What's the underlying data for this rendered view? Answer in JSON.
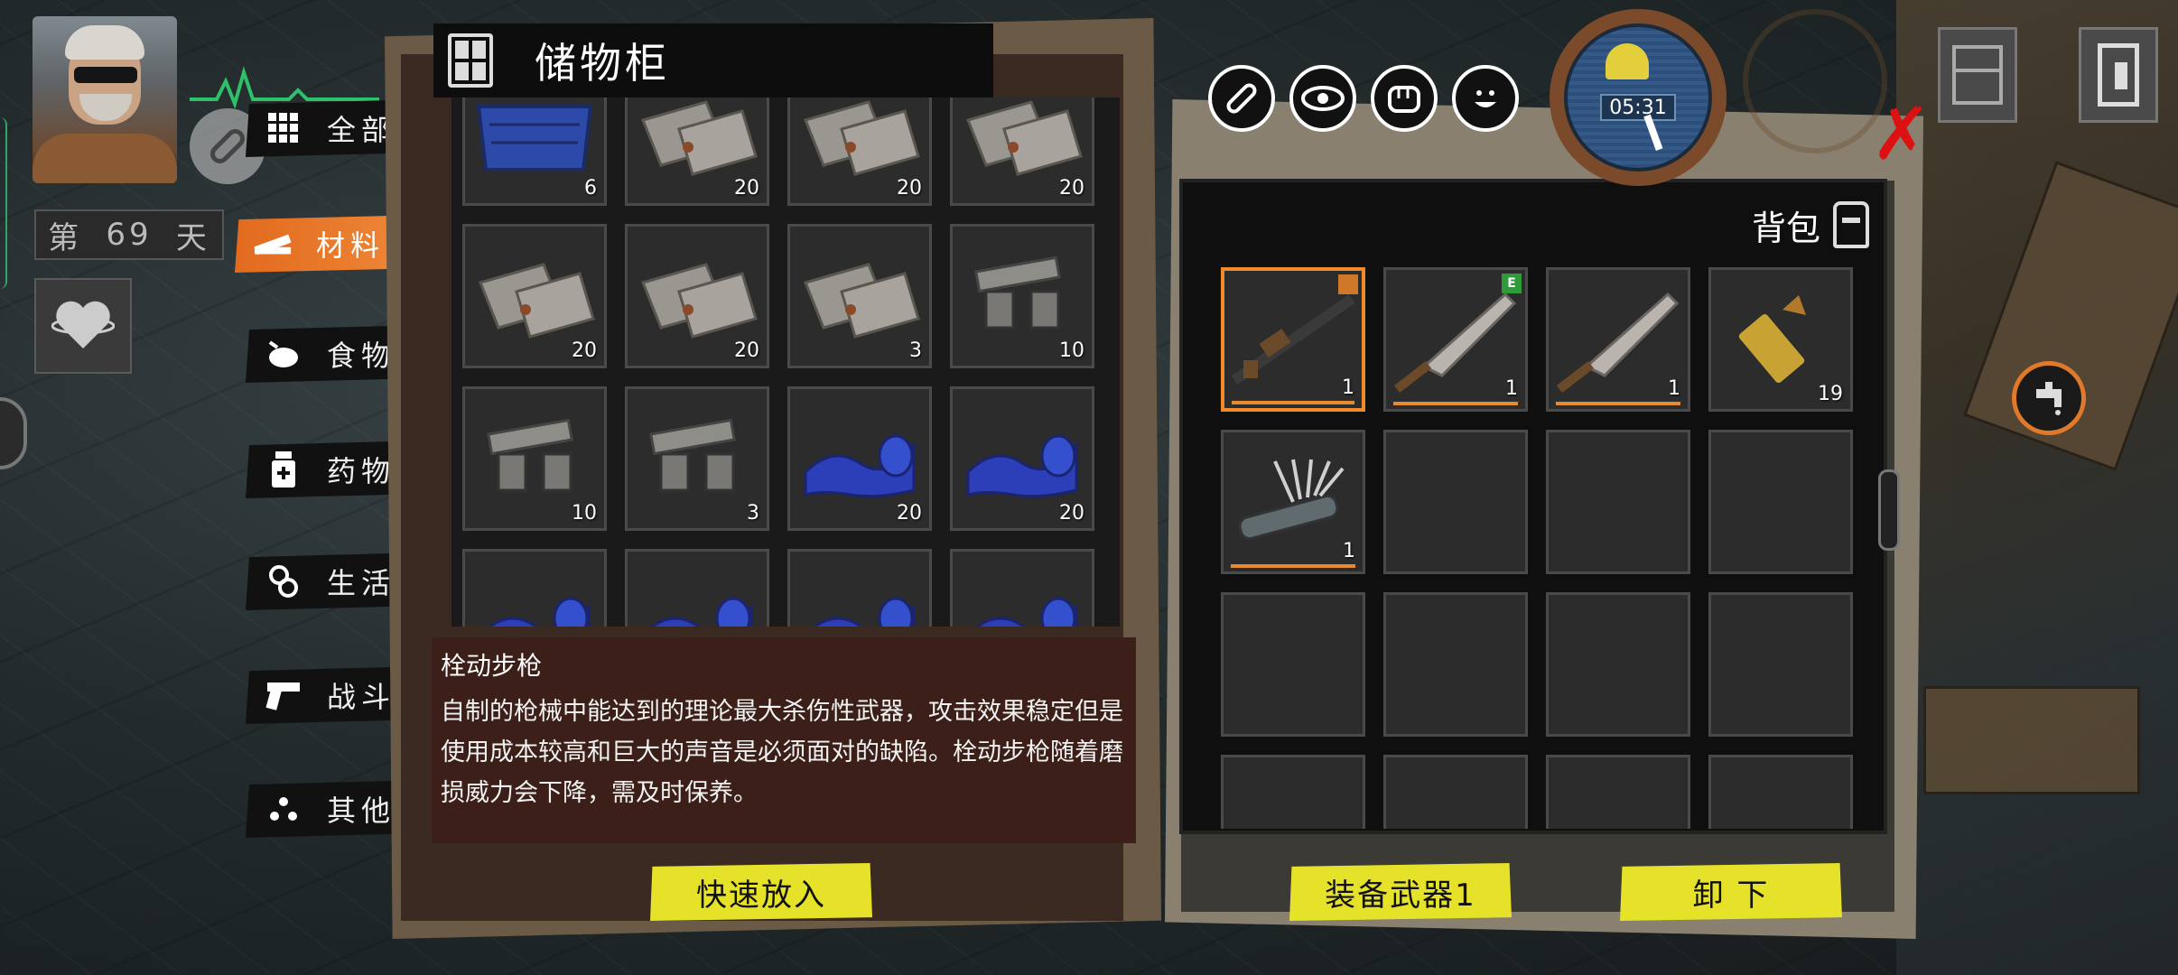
{
  "hud": {
    "day_prefix": "第",
    "day_number": "69",
    "day_suffix": "天",
    "clock_time": "05:31"
  },
  "categories": [
    {
      "label": "全部",
      "icon": "grid-icon",
      "active": false
    },
    {
      "label": "材料",
      "icon": "plank-icon",
      "active": true
    },
    {
      "label": "食物",
      "icon": "chicken-icon",
      "active": false
    },
    {
      "label": "药物",
      "icon": "medicine-bottle-icon",
      "active": false
    },
    {
      "label": "生活",
      "icon": "soap-icon",
      "active": false
    },
    {
      "label": "战斗",
      "icon": "pistol-icon",
      "active": false
    },
    {
      "label": "其他",
      "icon": "dots-icon",
      "active": false
    }
  ],
  "storage": {
    "title": "储物柜",
    "items": [
      {
        "type": "blue-crate",
        "count": "6"
      },
      {
        "type": "scrap-metal-sheets",
        "count": "20"
      },
      {
        "type": "scrap-metal-sheets",
        "count": "20"
      },
      {
        "type": "scrap-metal-sheets",
        "count": "20"
      },
      {
        "type": "scrap-metal-sheets",
        "count": "20"
      },
      {
        "type": "scrap-metal-sheets",
        "count": "20"
      },
      {
        "type": "scrap-metal-sheets",
        "count": "3"
      },
      {
        "type": "metal-parts",
        "count": "10"
      },
      {
        "type": "metal-parts",
        "count": "10"
      },
      {
        "type": "metal-parts",
        "count": "3"
      },
      {
        "type": "blue-cloth",
        "count": "20"
      },
      {
        "type": "blue-cloth",
        "count": "20"
      },
      {
        "type": "blue-cloth",
        "count": ""
      },
      {
        "type": "blue-cloth",
        "count": ""
      },
      {
        "type": "blue-cloth",
        "count": ""
      },
      {
        "type": "blue-cloth",
        "count": ""
      }
    ]
  },
  "description": {
    "name": "栓动步枪",
    "text": "自制的枪械中能达到的理论最大杀伤性武器，攻击效果稳定但是使用成本较高和巨大的声音是必须面对的缺陷。栓动步枪随着磨损威力会下降，需及时保养。"
  },
  "buttons": {
    "quick_store": "快速放入",
    "equip_weapon": "装备武器1",
    "unequip": "卸 下"
  },
  "backpack": {
    "title": "背包",
    "items": [
      {
        "type": "bolt-action-rifle",
        "count": "1",
        "selected": true,
        "badge": "rifle-badge"
      },
      {
        "type": "machete",
        "count": "1",
        "selected": false,
        "badge": "E"
      },
      {
        "type": "machete",
        "count": "1",
        "selected": false,
        "badge": ""
      },
      {
        "type": "rifle-bullet",
        "count": "19",
        "selected": false,
        "badge": ""
      },
      {
        "type": "lockpick-set",
        "count": "1",
        "selected": false,
        "badge": ""
      },
      {
        "type": "empty",
        "count": ""
      },
      {
        "type": "empty",
        "count": ""
      },
      {
        "type": "empty",
        "count": ""
      },
      {
        "type": "empty",
        "count": ""
      },
      {
        "type": "empty",
        "count": ""
      },
      {
        "type": "empty",
        "count": ""
      },
      {
        "type": "empty",
        "count": ""
      },
      {
        "type": "empty",
        "count": ""
      },
      {
        "type": "empty",
        "count": ""
      },
      {
        "type": "empty",
        "count": ""
      },
      {
        "type": "empty",
        "count": ""
      }
    ]
  },
  "status_icons": [
    "pill-icon",
    "eye-icon",
    "fist-icon",
    "smile-icon"
  ],
  "colors": {
    "accent_orange": "#f08a2a",
    "button_yellow": "#e6e22a",
    "close_red": "#d11111",
    "durability": "#e88a30"
  }
}
